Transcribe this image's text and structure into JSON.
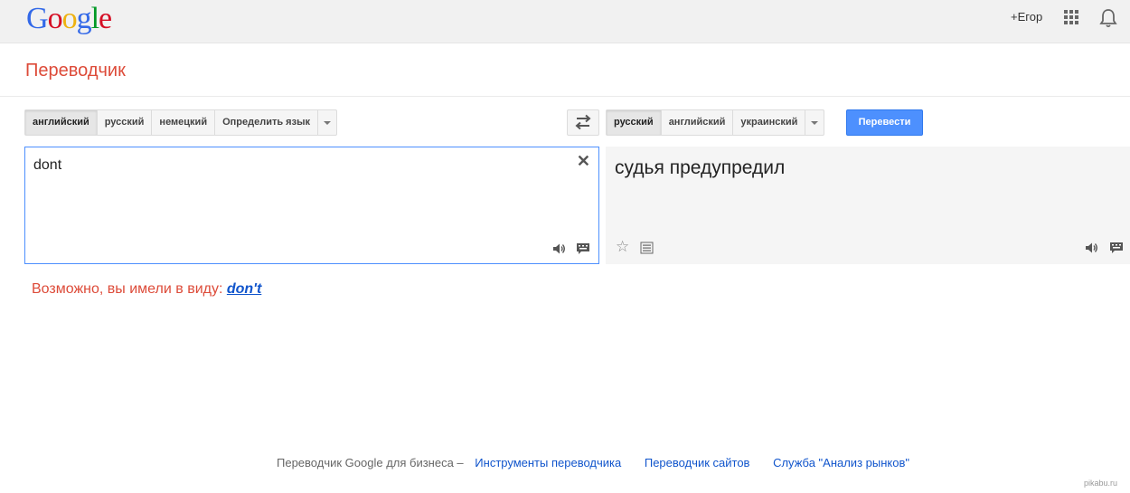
{
  "header": {
    "logo_letters": [
      {
        "char": "G",
        "color": "#3369e8"
      },
      {
        "char": "o",
        "color": "#d50f25"
      },
      {
        "char": "o",
        "color": "#eeb211"
      },
      {
        "char": "g",
        "color": "#3369e8"
      },
      {
        "char": "l",
        "color": "#009925"
      },
      {
        "char": "e",
        "color": "#d50f25"
      }
    ],
    "user_label": "+Егор",
    "apps_icon": "apps-grid-icon",
    "notifications_icon": "bell-icon"
  },
  "page_title": "Переводчик",
  "source_languages": {
    "items": [
      "английский",
      "русский",
      "немецкий",
      "Определить язык"
    ],
    "active": "английский"
  },
  "target_languages": {
    "items": [
      "русский",
      "английский",
      "украинский"
    ],
    "active": "русский"
  },
  "translate_button": "Перевести",
  "source": {
    "text": "dont",
    "clear_icon": "close-icon"
  },
  "translation": {
    "text": "судья предупредил"
  },
  "suggestion": {
    "prefix": "Возможно, вы имели в виду:",
    "link": "don't"
  },
  "footer": {
    "business_text": "Переводчик Google для бизнеса –",
    "links": [
      "Инструменты переводчика",
      "Переводчик сайтов",
      "Служба \"Анализ рынков\""
    ]
  },
  "watermark": "pikabu.ru",
  "colors": {
    "accent_red": "#dd4b39",
    "primary_blue": "#4d90fe",
    "link_blue": "#1155cc"
  }
}
